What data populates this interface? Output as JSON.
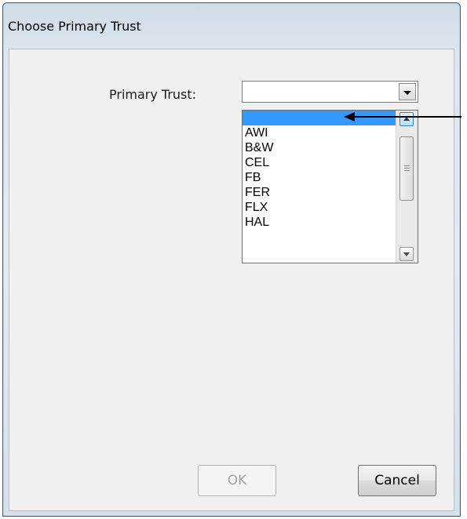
{
  "window": {
    "title": "Choose Primary Trust"
  },
  "form": {
    "primary_trust_label": "Primary Trust:",
    "primary_trust_value": ""
  },
  "dropdown": {
    "items": [
      "",
      "AWI",
      "B&W",
      "CEL",
      "FB",
      "FER",
      "FLX",
      "HAL"
    ],
    "selected_index": 0
  },
  "buttons": {
    "ok_label": "OK",
    "ok_enabled": false,
    "cancel_label": "Cancel"
  },
  "colors": {
    "selection": "#3399ff",
    "client_bg": "#f0f0f0"
  }
}
